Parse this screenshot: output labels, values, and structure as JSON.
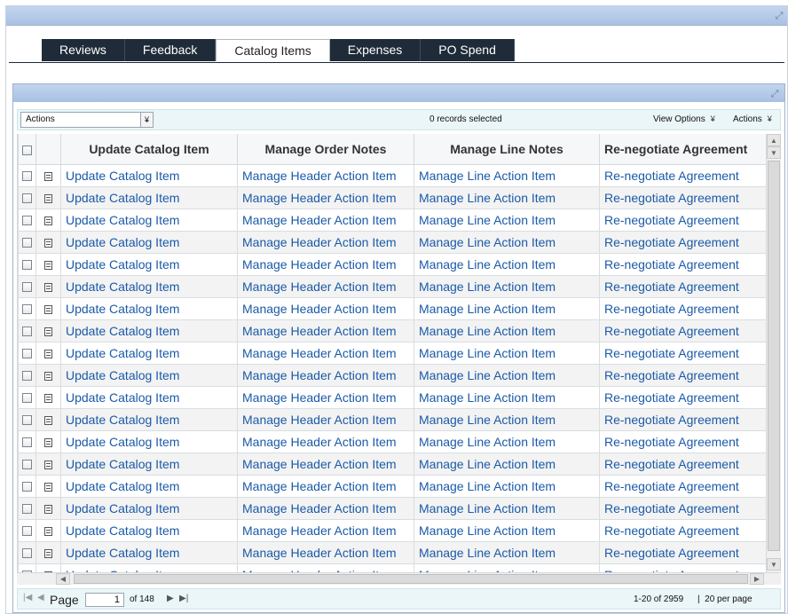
{
  "tabs": [
    {
      "label": "Reviews",
      "active": false
    },
    {
      "label": "Feedback",
      "active": false
    },
    {
      "label": "Catalog Items",
      "active": true
    },
    {
      "label": "Expenses",
      "active": false
    },
    {
      "label": "PO Spend",
      "active": false
    }
  ],
  "toolbar": {
    "actions_select": "Actions",
    "records_selected": "0 records selected",
    "view_options": "View Options",
    "actions_menu": "Actions"
  },
  "table": {
    "headers": [
      "Update Catalog Item",
      "Manage Order Notes",
      "Manage Line Notes",
      "Re-negotiate Agreement"
    ],
    "row_values": [
      "Update Catalog Item",
      "Manage Header Action Item",
      "Manage Line Action Item",
      "Re-negotiate Agreement"
    ],
    "visible_rows": 19
  },
  "pager": {
    "page_label": "Page",
    "current_page": "1",
    "of_pages": "of 148",
    "range": "1-20 of 2959",
    "per_page": "20 per page"
  },
  "colors": {
    "link": "#1a5aa8",
    "header_bar": "#b5cae9",
    "tab_dark": "#1f2b38",
    "toolbar_bg": "#eaf6f7"
  }
}
